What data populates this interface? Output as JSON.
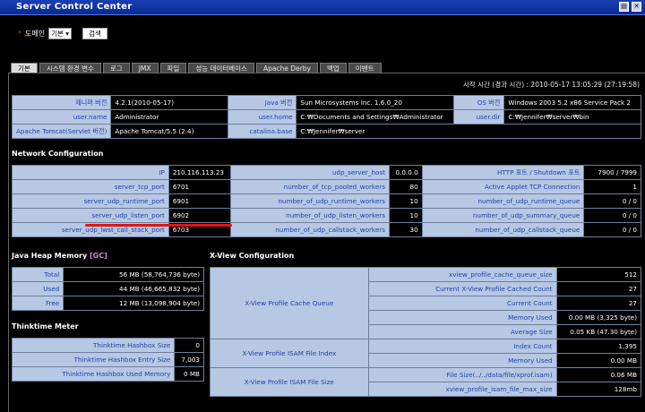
{
  "window": {
    "title": "Server Control Center"
  },
  "domain": {
    "label": "도메인",
    "selected": "기본",
    "button": "검색"
  },
  "tabs": [
    "기본",
    "시스템 환경 변수",
    "로그",
    "JMX",
    "파일",
    "성능 데이터베이스",
    "Apache Derby",
    "백업",
    "이벤트"
  ],
  "start_time": "시작 시간 (경과 시간) : 2010-05-17 13:05:29 (27:19:58)",
  "system": [
    [
      [
        "제니퍼 버전",
        "4.2.1(2010-05-17)"
      ],
      [
        "Java 버전",
        "Sun Microsystems Inc. 1.6.0_20"
      ],
      [
        "OS 버전",
        "Windows 2003 5.2 x86 Service Pack 2"
      ]
    ],
    [
      [
        "user.name",
        "Administrator"
      ],
      [
        "user.home",
        "C:₩Documents and Settings₩Administrator"
      ],
      [
        "user.dir",
        "C:₩Jennifer₩server₩bin"
      ]
    ],
    [
      [
        "Apache Tomcat(Servlet 버전)",
        "Apache Tomcat/5.5 (2.4)"
      ],
      [
        "catalina.base",
        "C:₩Jennifer₩server"
      ]
    ]
  ],
  "network": {
    "title": "Network Configuration",
    "rows": [
      [
        [
          "IP",
          "210.116.113.23"
        ],
        [
          "udp_server_host",
          "0.0.0.0"
        ],
        [
          "HTTP 포트 / Shutdown 포트",
          "7900 / 7999"
        ]
      ],
      [
        [
          "server_tcp_port",
          "6701"
        ],
        [
          "number_of_tcp_pooled_workers",
          "80"
        ],
        [
          "Active Applet TCP Connection",
          "1"
        ]
      ],
      [
        [
          "server_udp_runtime_port",
          "6901"
        ],
        [
          "number_of_udp_runtime_workers",
          "10"
        ],
        [
          "number_of_udp_runtime_queue",
          "0 / 0"
        ]
      ],
      [
        [
          "server_udp_listen_port",
          "6902"
        ],
        [
          "number_of_udp_listen_workers",
          "10"
        ],
        [
          "number_of_udp_summary_queue",
          "0 / 0"
        ]
      ],
      [
        [
          "server_udp_lwst_call_stack_port",
          "6703"
        ],
        [
          "number_of_udp_callstack_workers",
          "30"
        ],
        [
          "number_of_udp_callstack_queue",
          "0 / 0"
        ]
      ]
    ]
  },
  "heap": {
    "title": "Java Heap Memory",
    "gc": "[GC]",
    "rows": [
      [
        "Total",
        "56 MB (58,764,736 byte)"
      ],
      [
        "Used",
        "44 MB (46,665,832 byte)"
      ],
      [
        "Free",
        "12 MB (13,098,904 byte)"
      ]
    ]
  },
  "thinktime": {
    "title": "Thinktime Meter",
    "rows": [
      [
        "Thinktime Hashbox Size",
        "0"
      ],
      [
        "Thinktime Hashbox Entry Size",
        "7,003"
      ],
      [
        "Thinktime Hashbox Used Memory",
        "0 MB"
      ]
    ]
  },
  "xview": {
    "title": "X-View Configuration",
    "groups": [
      {
        "label": "X-View Profile Cache Queue",
        "rows": [
          [
            "xview_profile_cache_queue_size",
            "512"
          ],
          [
            "Current X-View Profile Cached Count",
            "27"
          ],
          [
            "Current Count",
            "27"
          ],
          [
            "Memory Used",
            "0.00 MB (3,325 byte)"
          ],
          [
            "Average Size",
            "0.05 KB (47.30 byte)"
          ]
        ]
      },
      {
        "label": "X-View Profile ISAM File Index",
        "rows": [
          [
            "Index Count",
            "1,395"
          ],
          [
            "Memory Used",
            "0.00 MB"
          ]
        ]
      },
      {
        "label": "X-View Profile ISAM File Size",
        "rows": [
          [
            "File Size(../../data/file/xprof.isam)",
            "0.06 MB"
          ],
          [
            "xview_profile_isam_file_max_size",
            "128mb"
          ]
        ]
      }
    ]
  }
}
